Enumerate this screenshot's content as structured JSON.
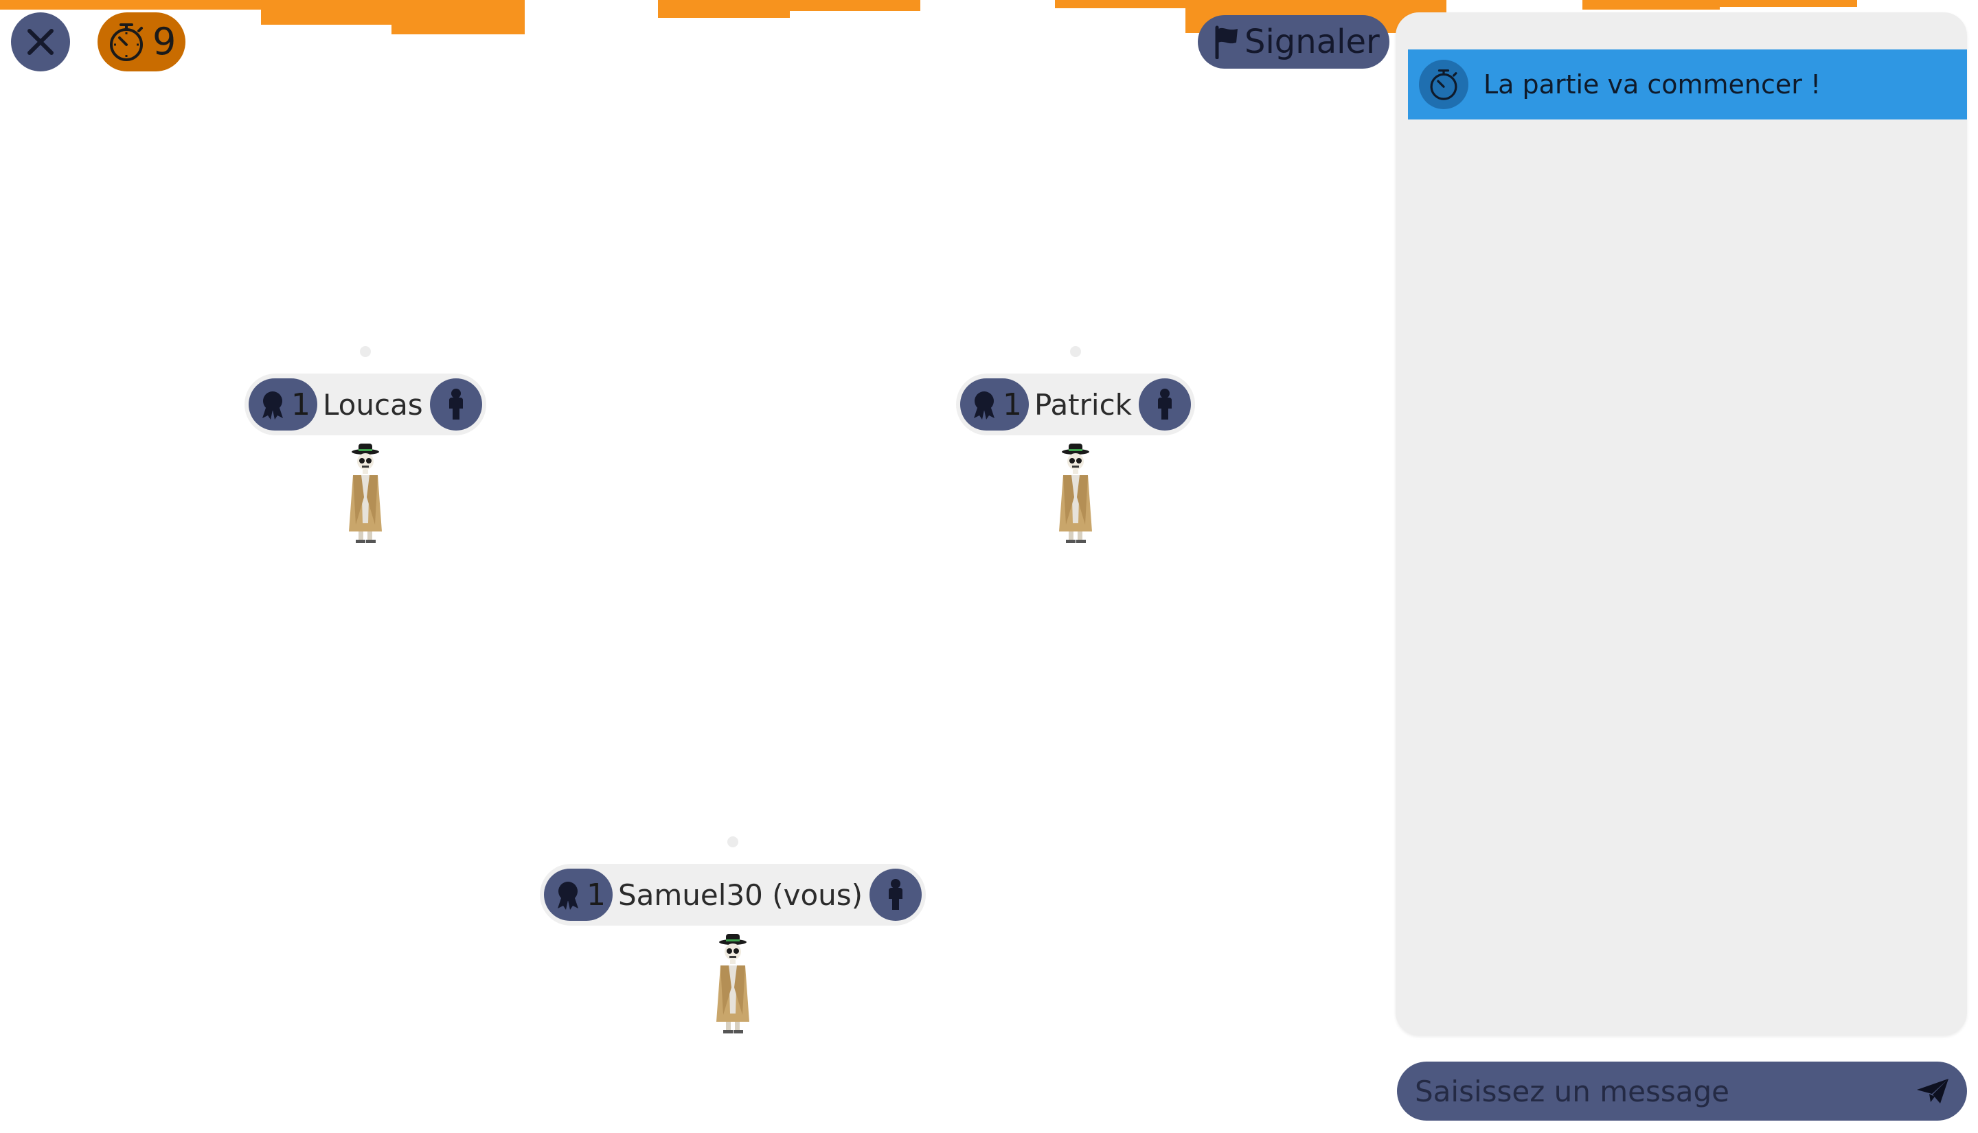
{
  "game": {
    "timer": "9",
    "report_label": "Signaler"
  },
  "players": [
    {
      "rank": "1",
      "name": "Loucas"
    },
    {
      "rank": "1",
      "name": "Patrick"
    },
    {
      "rank": "1",
      "name": "Samuel30 (vous)"
    }
  ],
  "chat": {
    "messages": [
      {
        "text": "La partie va commencer !"
      }
    ],
    "input_placeholder": "Saisissez un message"
  },
  "colors": {
    "chip": "#4d5880",
    "timer": "#c96c00",
    "ribbon": "#f7931e",
    "message": "#2f97e3",
    "chat_bg": "#eeeeee"
  },
  "icons": {
    "close": "close-icon",
    "timer": "stopwatch-icon",
    "report": "flag-icon",
    "rank": "award-icon",
    "role": "person-icon",
    "send": "send-icon"
  }
}
